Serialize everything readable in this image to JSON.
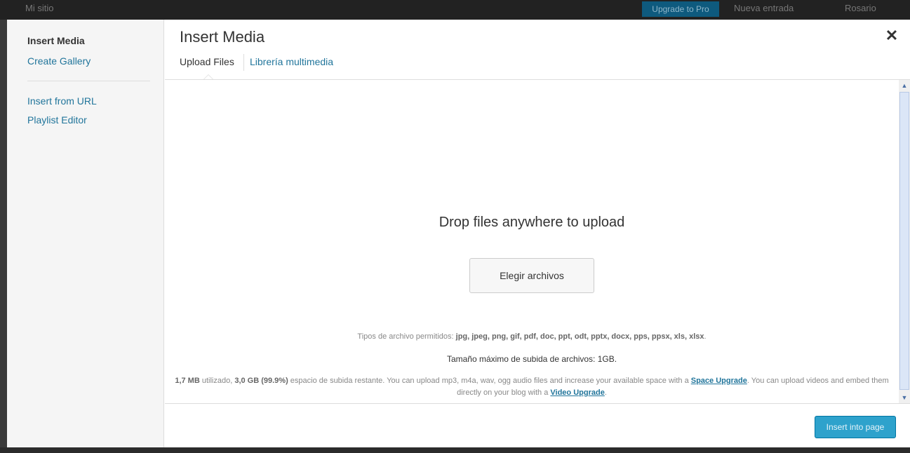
{
  "background": {
    "site_name": "Mi sitio",
    "upgrade_label": "Upgrade to Pro",
    "new_entry_label": "Nueva entrada",
    "user_label": "Rosario"
  },
  "modal": {
    "title": "Insert Media",
    "close_glyph": "✕",
    "menu": {
      "active": "Insert Media",
      "items": [
        {
          "label": "Create Gallery"
        },
        {
          "label": "Insert from URL"
        },
        {
          "label": "Playlist Editor"
        }
      ]
    },
    "tabs": [
      {
        "label": "Upload Files",
        "active": true
      },
      {
        "label": "Librería multimedia",
        "active": false
      }
    ],
    "uploader": {
      "drop_text": "Drop files anywhere to upload",
      "choose_button": "Elegir archivos",
      "allowed_prefix": "Tipos de archivo permitidos: ",
      "allowed_types": "jpg, jpeg, png, gif, pdf, doc, ppt, odt, pptx, docx, pps, ppsx, xls, xlsx",
      "allowed_suffix": ".",
      "max_size": "Tamaño máximo de subida de archivos: 1GB.",
      "quota": {
        "used": "1,7 MB",
        "used_text": " utilizado, ",
        "remaining": "3,0 GB (99.9%)",
        "text1": " espacio de subida restante. You can upload mp3, m4a, wav, ogg audio files and increase your available space with a ",
        "space_link": "Space Upgrade",
        "text2": ". You can upload videos and embed them directly on your blog with a ",
        "video_link": "Video Upgrade",
        "text3": "."
      }
    },
    "footer": {
      "insert_button": "Insert into page"
    }
  },
  "colors": {
    "link": "#21759b",
    "primary_button": "#2ea2cc",
    "backdrop": "#222222"
  }
}
